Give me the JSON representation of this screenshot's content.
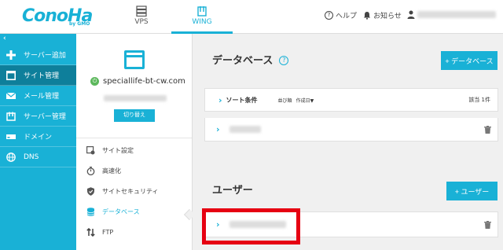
{
  "header": {
    "logo_text": "ConoHa",
    "logo_sub": "by GMO",
    "tabs": [
      {
        "label": "VPS",
        "icon": "server-icon"
      },
      {
        "label": "WING",
        "icon": "wing-icon"
      }
    ],
    "help_label": "ヘルプ",
    "notice_label": "お知らせ",
    "accent_color": "#19b1d6"
  },
  "sidebar": {
    "collapse_symbol": "‹",
    "items": [
      {
        "label": "サーバー追加",
        "icon": "plus-icon"
      },
      {
        "label": "サイト管理",
        "icon": "site-icon"
      },
      {
        "label": "メール管理",
        "icon": "mail-icon"
      },
      {
        "label": "サーバー管理",
        "icon": "server-manage-icon"
      },
      {
        "label": "ドメイン",
        "icon": "domain-icon"
      },
      {
        "label": "DNS",
        "icon": "globe-icon"
      }
    ]
  },
  "site_panel": {
    "site_name": "speciallife-bt-cw.com",
    "switch_button": "切り替え",
    "menu": [
      {
        "label": "サイト設定",
        "icon": "site-settings-icon"
      },
      {
        "label": "高速化",
        "icon": "stopwatch-icon"
      },
      {
        "label": "サイトセキュリティ",
        "icon": "shield-icon"
      },
      {
        "label": "データベース",
        "icon": "database-icon"
      },
      {
        "label": "FTP",
        "icon": "ftp-icon"
      }
    ]
  },
  "main": {
    "db_title": "データベース",
    "help_symbol": "?",
    "add_db_button": "+ データベース",
    "sort_label": "ソート条件",
    "order_label": "並び順",
    "order_value": "作成日▼",
    "count_label": "該当 1件",
    "user_title": "ユーザー",
    "add_user_button": "+ ユーザー"
  }
}
